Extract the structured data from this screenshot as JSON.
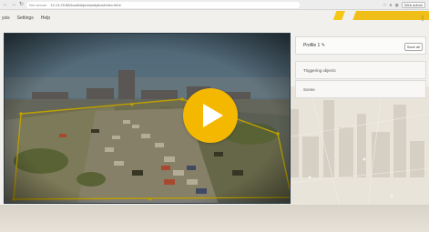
{
  "browser": {
    "insecure_label": "Not secure",
    "url": "10.13.29.88/local/objectanalytics/index.html",
    "action_button": "Web admin"
  },
  "menu": {
    "items": [
      "ysis",
      "Settings",
      "Help"
    ]
  },
  "panel": {
    "profile_label": "Profile 1 ✎",
    "profile_button": "Save all",
    "section_triggering": "Triggering objects",
    "section_scene": "Scene"
  },
  "colors": {
    "accent": "#f5b800",
    "zone": "#e8c200"
  },
  "icons": {
    "play": "play-icon",
    "menu": "kebab-menu-icon"
  }
}
